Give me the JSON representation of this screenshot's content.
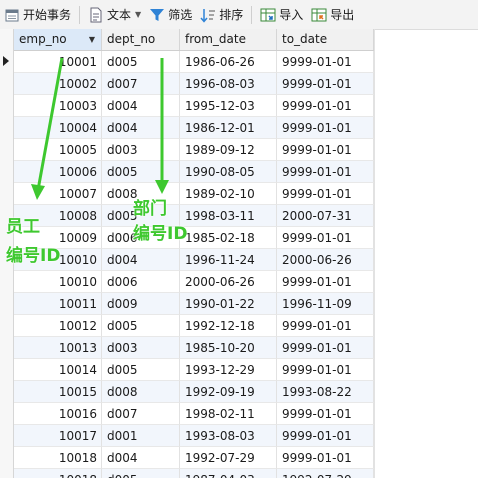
{
  "toolbar": {
    "begin_transaction": "开始事务",
    "text": "文本",
    "filter": "筛选",
    "sort": "排序",
    "import": "导入",
    "export": "导出"
  },
  "columns": [
    "emp_no",
    "dept_no",
    "from_date",
    "to_date"
  ],
  "rows": [
    [
      "10001",
      "d005",
      "1986-06-26",
      "9999-01-01"
    ],
    [
      "10002",
      "d007",
      "1996-08-03",
      "9999-01-01"
    ],
    [
      "10003",
      "d004",
      "1995-12-03",
      "9999-01-01"
    ],
    [
      "10004",
      "d004",
      "1986-12-01",
      "9999-01-01"
    ],
    [
      "10005",
      "d003",
      "1989-09-12",
      "9999-01-01"
    ],
    [
      "10006",
      "d005",
      "1990-08-05",
      "9999-01-01"
    ],
    [
      "10007",
      "d008",
      "1989-02-10",
      "9999-01-01"
    ],
    [
      "10008",
      "d005",
      "1998-03-11",
      "2000-07-31"
    ],
    [
      "10009",
      "d006",
      "1985-02-18",
      "9999-01-01"
    ],
    [
      "10010",
      "d004",
      "1996-11-24",
      "2000-06-26"
    ],
    [
      "10010",
      "d006",
      "2000-06-26",
      "9999-01-01"
    ],
    [
      "10011",
      "d009",
      "1990-01-22",
      "1996-11-09"
    ],
    [
      "10012",
      "d005",
      "1992-12-18",
      "9999-01-01"
    ],
    [
      "10013",
      "d003",
      "1985-10-20",
      "9999-01-01"
    ],
    [
      "10014",
      "d005",
      "1993-12-29",
      "9999-01-01"
    ],
    [
      "10015",
      "d008",
      "1992-09-19",
      "1993-08-22"
    ],
    [
      "10016",
      "d007",
      "1998-02-11",
      "9999-01-01"
    ],
    [
      "10017",
      "d001",
      "1993-08-03",
      "9999-01-01"
    ],
    [
      "10018",
      "d004",
      "1992-07-29",
      "9999-01-01"
    ],
    [
      "10018",
      "d005",
      "1987-04-03",
      "1992-07-29"
    ]
  ],
  "annotations": {
    "employee_line1": "员工",
    "employee_line2": "编号ID",
    "dept_line1": "部门",
    "dept_line2": "编号ID"
  },
  "colors": {
    "annotation": "#3ec82f",
    "active_header": "#dce9f8",
    "row_alt": "#f2f6fc"
  }
}
